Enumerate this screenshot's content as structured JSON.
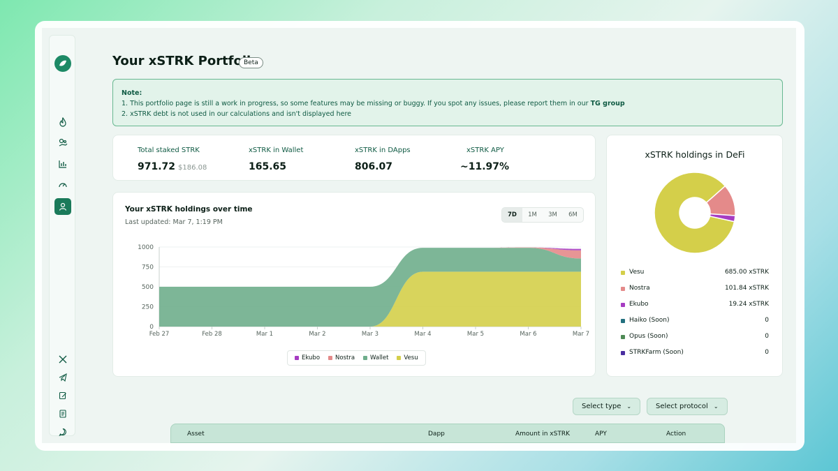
{
  "page": {
    "title": "Your xSTRK Portfolio",
    "badge": "Beta"
  },
  "note": {
    "heading": "Note:",
    "line1": "1. This portfolio page is still a work in progress, so some features may be missing or buggy. If you spot any issues, please report them in our ",
    "line1_link": "TG group",
    "line2": "2. xSTRK debt is not used in our calculations and isn't displayed here"
  },
  "stats": [
    {
      "label": "Total staked STRK",
      "value": "971.72",
      "sub": "$186.08"
    },
    {
      "label": "xSTRK in Wallet",
      "value": "165.65"
    },
    {
      "label": "xSTRK in DApps",
      "value": "806.07"
    },
    {
      "label": "xSTRK APY",
      "value": "~11.97%"
    }
  ],
  "holdings_chart": {
    "title": "Your xSTRK holdings over time",
    "updated": "Last updated: Mar 7, 1:19 PM",
    "ranges": [
      "7D",
      "1M",
      "3M",
      "6M"
    ],
    "active_range": "7D"
  },
  "defi": {
    "title": "xSTRK holdings in DeFi",
    "items": [
      {
        "name": "Vesu",
        "amount": "685.00 xSTRK",
        "color": "#d4cf4a"
      },
      {
        "name": "Nostra",
        "amount": "101.84 xSTRK",
        "color": "#e48a8a"
      },
      {
        "name": "Ekubo",
        "amount": "19.24 xSTRK",
        "color": "#a63cc2"
      },
      {
        "name": "Haiko (Soon)",
        "amount": "0",
        "color": "#23707f"
      },
      {
        "name": "Opus (Soon)",
        "amount": "0",
        "color": "#4e8a55"
      },
      {
        "name": "STRKFarm (Soon)",
        "amount": "0",
        "color": "#4a2ea0"
      }
    ]
  },
  "filters": {
    "type": "Select type",
    "protocol": "Select protocol"
  },
  "table": {
    "columns": [
      "Asset",
      "Dapp",
      "Amount in xSTRK",
      "APY",
      "Action"
    ]
  },
  "chart_data": {
    "type": "area",
    "stacked": true,
    "x": [
      "Feb 27",
      "Feb 28",
      "Mar 1",
      "Mar 2",
      "Mar 3",
      "Mar 4",
      "Mar 5",
      "Mar 6",
      "Mar 7"
    ],
    "ylim": [
      0,
      1000
    ],
    "yticks": [
      0,
      250,
      500,
      750,
      1000
    ],
    "legend": "bottom",
    "series": [
      {
        "name": "Ekubo",
        "color": "#a63cc2",
        "values": [
          0,
          0,
          0,
          0,
          0,
          0,
          0,
          0,
          19
        ]
      },
      {
        "name": "Nostra",
        "color": "#e48a8a",
        "values": [
          0,
          0,
          0,
          0,
          0,
          0,
          0,
          5,
          102
        ]
      },
      {
        "name": "Wallet",
        "color": "#6fae8c",
        "values": [
          500,
          500,
          500,
          500,
          500,
          300,
          300,
          300,
          166
        ]
      },
      {
        "name": "Vesu",
        "color": "#d4cf4a",
        "values": [
          0,
          0,
          0,
          0,
          0,
          690,
          690,
          690,
          690
        ]
      }
    ],
    "pie": {
      "labels": [
        "Vesu",
        "Nostra",
        "Ekubo"
      ],
      "values": [
        685.0,
        101.84,
        19.24
      ]
    }
  }
}
